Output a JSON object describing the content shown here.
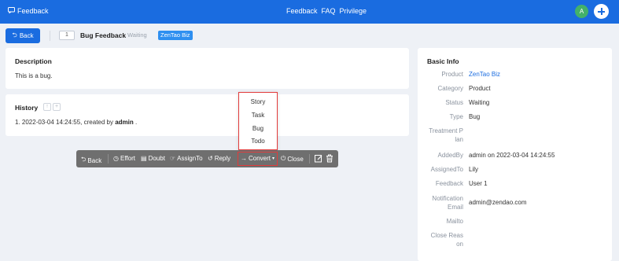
{
  "topbar": {
    "brand": "Feedback",
    "nav": [
      "Feedback",
      "FAQ",
      "Privilege"
    ],
    "avatar_letter": "A",
    "colors": {
      "bar": "#1a6ce0",
      "avatar": "#43b16a"
    }
  },
  "header": {
    "back_label": "Back",
    "id": "1",
    "title": "Bug Feedback",
    "status": "Waiting",
    "product_tag": "ZenTao Biz"
  },
  "description": {
    "heading": "Description",
    "text": "This is a bug."
  },
  "history": {
    "heading": "History",
    "entry_prefix": "1. 2022-03-04 14:24:55, created by ",
    "entry_user": "admin",
    "entry_suffix": " ."
  },
  "actions": {
    "back": "Back",
    "effort": "Effort",
    "doubt": "Doubt",
    "assign": "AssignTo",
    "reply": "Reply",
    "convert": "Convert",
    "close": "Close"
  },
  "convert_menu": [
    "Story",
    "Task",
    "Bug",
    "Todo"
  ],
  "basic_info": {
    "heading": "Basic Info",
    "rows": [
      {
        "label": "Product",
        "value": "ZenTao Biz"
      },
      {
        "label": "Category",
        "value": "Product"
      },
      {
        "label": "Status",
        "value": "Waiting"
      },
      {
        "label": "Type",
        "value": "Bug"
      },
      {
        "label_1": "Treatment P",
        "label_2": "lan",
        "value": ""
      },
      {
        "label": "AddedBy",
        "value": "admin on 2022-03-04 14:24:55"
      },
      {
        "label": "AssignedTo",
        "value": "Lily"
      },
      {
        "label": "Feedback",
        "value": "User 1"
      },
      {
        "label_1": "Notification",
        "label_2": "Email",
        "value": "admin@zendao.com"
      },
      {
        "label": "Mailto",
        "value": ""
      },
      {
        "label_1": "Close Reas",
        "label_2": "on",
        "value": ""
      }
    ]
  }
}
